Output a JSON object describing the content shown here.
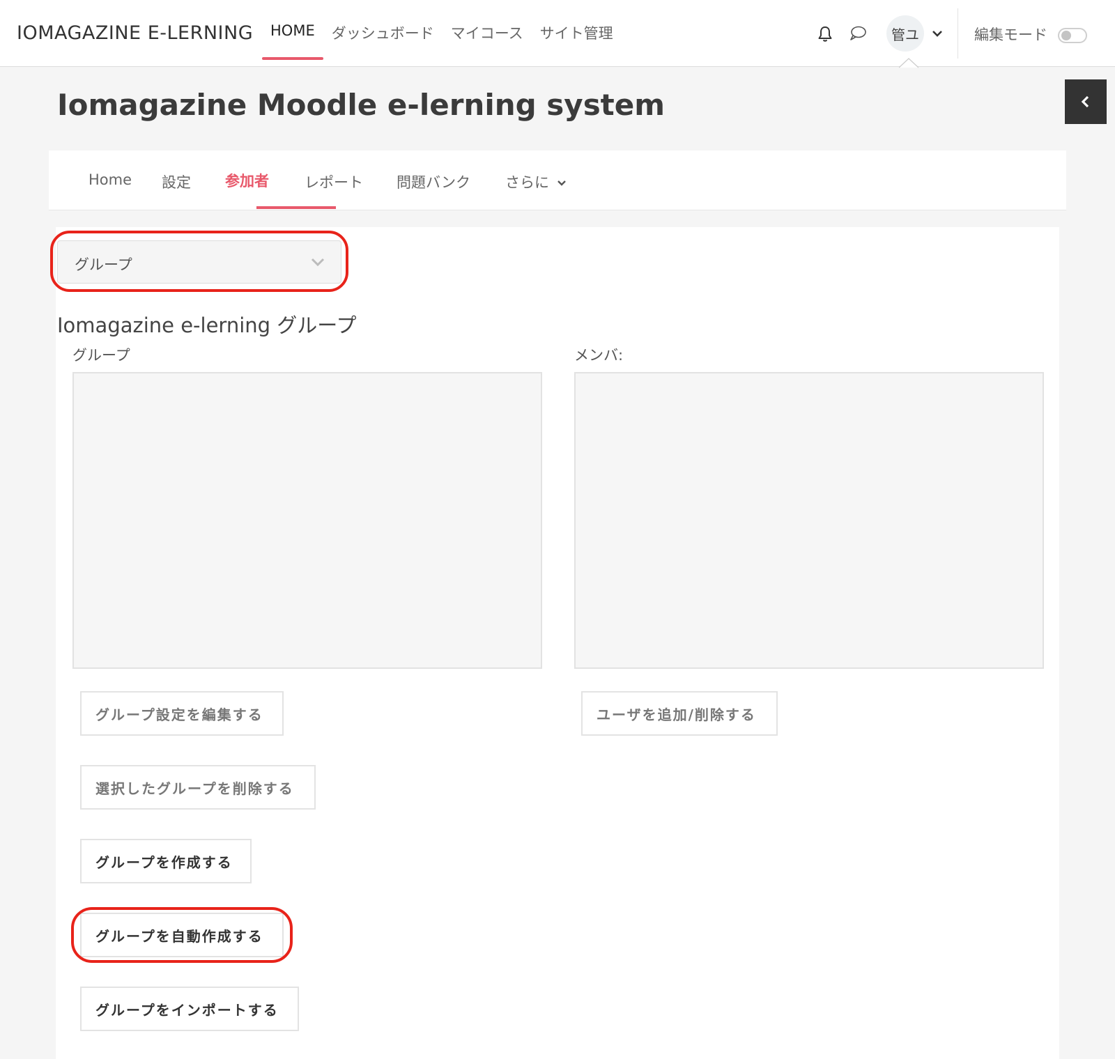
{
  "topbar": {
    "brand": "IOMAGAZINE E-LERNING",
    "nav": [
      "HOME",
      "ダッシュボード",
      "マイコース",
      "サイト管理"
    ],
    "avatar_text": "管ユ",
    "edit_mode_label": "編集モード",
    "edit_mode_on": false,
    "icons": [
      "bell-icon",
      "chat-icon",
      "chevron-down-icon"
    ]
  },
  "page": {
    "title": "Iomagazine Moodle e-lerning system"
  },
  "secondary_nav": {
    "items": [
      "Home",
      "設定",
      "参加者",
      "レポート",
      "問題バンク",
      "さらに"
    ],
    "active_index": 2
  },
  "groups_page": {
    "select_value": "グループ",
    "course_heading": "Iomagazine e-lerning グループ",
    "groups_label": "グループ",
    "members_label": "メンバ:",
    "buttons": {
      "edit_group_settings": "グループ設定を編集する",
      "add_remove_users": "ユーザを追加/削除する",
      "delete_selected": "選択したグループを削除する",
      "create_group": "グループを作成する",
      "auto_create": "グループを自動作成する",
      "import_groups": "グループをインポートする"
    }
  },
  "colors": {
    "accent": "#e8596b",
    "highlight": "#e8231a",
    "drawer": "#333333"
  }
}
